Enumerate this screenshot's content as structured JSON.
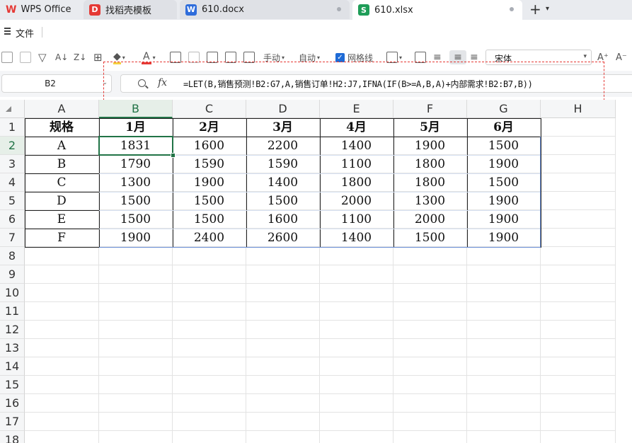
{
  "tabs": [
    {
      "label": "WPS Office",
      "icon": "wps-logo-icon",
      "color": "#e53935"
    },
    {
      "label": "找稻壳模板",
      "icon": "docer-icon",
      "color": "#e53935"
    },
    {
      "label": "610.docx",
      "icon": "word-doc-icon",
      "color": "#2f6ddb"
    },
    {
      "label": "610.xlsx",
      "icon": "sheet-icon",
      "color": "#1f9d58"
    }
  ],
  "menu": {
    "file_label": "文件"
  },
  "toolbar": {
    "manual_label": "手动",
    "auto_label": "自动",
    "gridlines_label": "网格线",
    "font_name": "宋体"
  },
  "formula_bar": {
    "cell_ref": "B2",
    "formula": "=LET(B,销售预测!B2:G7,A,销售订单!H2:J7,IFNA(IF(B>=A,B,A)+内部需求!B2:B7,B))"
  },
  "accent_color": "#217346",
  "highlight_color": "#e53935",
  "sheet": {
    "columns": [
      "A",
      "B",
      "C",
      "D",
      "E",
      "F",
      "G",
      "H"
    ],
    "rows": [
      "1",
      "2",
      "3",
      "4",
      "5",
      "6",
      "7",
      "8",
      "9",
      "10",
      "11",
      "12",
      "13",
      "14",
      "15",
      "16",
      "17",
      "18"
    ],
    "selected_cell": "B2",
    "header": [
      "规格",
      "1月",
      "2月",
      "3月",
      "4月",
      "5月",
      "6月"
    ],
    "data": [
      [
        "A",
        "1831",
        "1600",
        "2200",
        "1400",
        "1900",
        "1500"
      ],
      [
        "B",
        "1790",
        "1590",
        "1590",
        "1100",
        "1800",
        "1900"
      ],
      [
        "C",
        "1300",
        "1900",
        "1400",
        "1800",
        "1800",
        "1500"
      ],
      [
        "D",
        "1500",
        "1500",
        "1500",
        "2000",
        "1300",
        "1900"
      ],
      [
        "E",
        "1500",
        "1500",
        "1600",
        "1100",
        "2000",
        "1900"
      ],
      [
        "F",
        "1900",
        "2400",
        "2600",
        "1400",
        "1500",
        "1900"
      ]
    ]
  }
}
